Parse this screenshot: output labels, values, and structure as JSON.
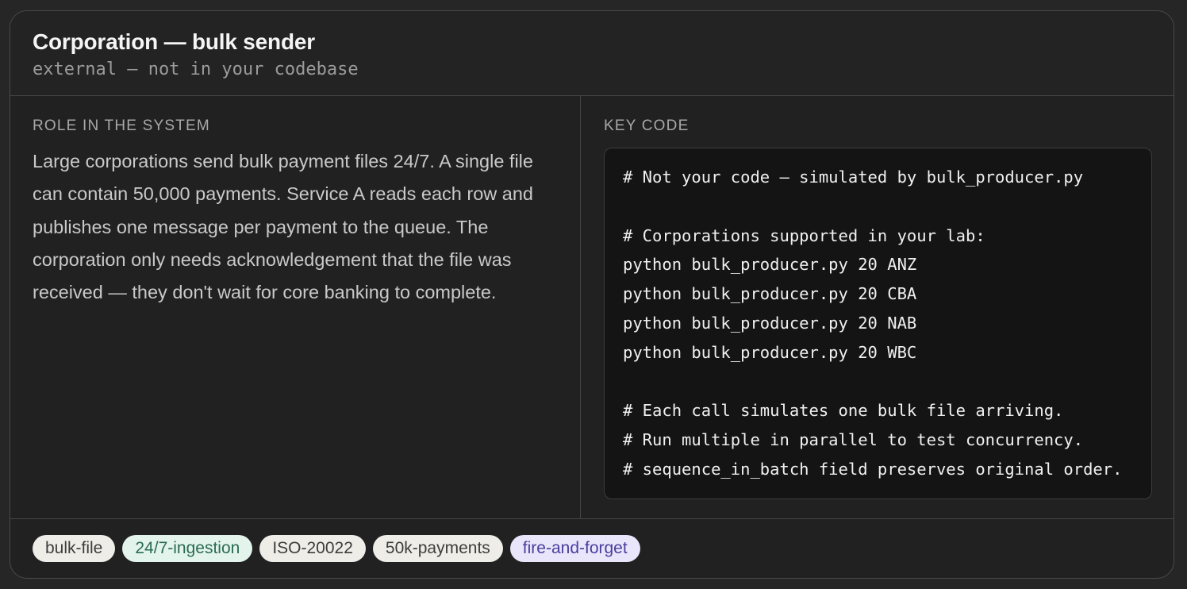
{
  "header": {
    "title": "Corporation — bulk sender",
    "subtitle": "external — not in your codebase"
  },
  "role": {
    "label": "ROLE IN THE SYSTEM",
    "text": "Large corporations send bulk payment files 24/7. A single file can contain 50,000 payments. Service A reads each row and publishes one message per payment to the queue. The corporation only needs acknowledgement that the file was received — they don't wait for core banking to complete."
  },
  "key_code": {
    "label": "KEY CODE",
    "lines": [
      "# Not your code — simulated by bulk_producer.py",
      "",
      "# Corporations supported in your lab:",
      "python bulk_producer.py 20 ANZ",
      "python bulk_producer.py 20 CBA",
      "python bulk_producer.py 20 NAB",
      "python bulk_producer.py 20 WBC",
      "",
      "# Each call simulates one bulk file arriving.",
      "# Run multiple in parallel to test concurrency.",
      "# sequence_in_batch field preserves original order."
    ]
  },
  "tags": [
    {
      "label": "bulk-file",
      "style": "neutral"
    },
    {
      "label": "24/7-ingestion",
      "style": "green"
    },
    {
      "label": "ISO-20022",
      "style": "neutral"
    },
    {
      "label": "50k-payments",
      "style": "neutral"
    },
    {
      "label": "fire-and-forget",
      "style": "purple"
    }
  ],
  "colors": {
    "tag_neutral_bg": "#eeede8",
    "tag_green_bg": "#e3f4ec",
    "tag_purple_bg": "#e9e6fb",
    "code_bg": "#141414",
    "card_bg": "#212121"
  }
}
